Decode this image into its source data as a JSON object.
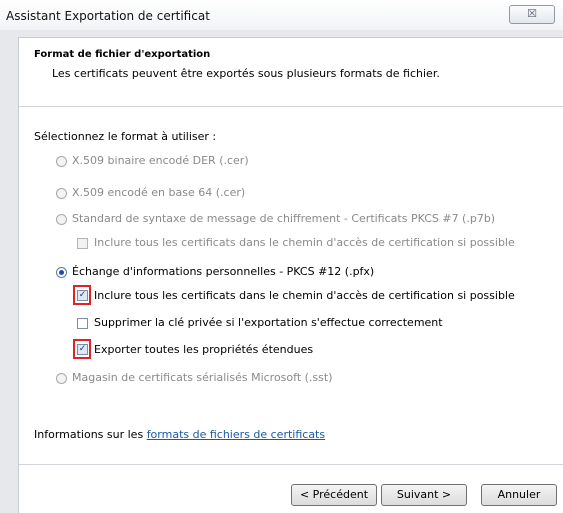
{
  "window": {
    "title": "Assistant Exportation de certificat",
    "close_glyph": "☒"
  },
  "header": {
    "title": "Format de fichier d'exportation",
    "subtitle": "Les certificats peuvent être exportés sous plusieurs formats de fichier."
  },
  "prompt": "Sélectionnez le format à utiliser :",
  "options": {
    "der": {
      "label": "X.509 binaire encodé DER (.cer)",
      "enabled": false,
      "selected": false
    },
    "base64": {
      "label": "X.509 encodé en base 64 (.cer)",
      "enabled": false,
      "selected": false
    },
    "pkcs7": {
      "label": "Standard de syntaxe de message de chiffrement - Certificats PKCS #7 (.p7b)",
      "enabled": false,
      "selected": false
    },
    "pkcs7_include": {
      "label": "Inclure tous les certificats dans le chemin d'accès de certification si possible",
      "checked": false,
      "enabled": false
    },
    "pfx": {
      "label": "Échange d'informations personnelles - PKCS #12 (.pfx)",
      "enabled": true,
      "selected": true
    },
    "pfx_include": {
      "label": "Inclure tous les certificats dans le chemin d'accès de certification si possible",
      "checked": true,
      "enabled": true
    },
    "pfx_delete_key": {
      "label": "Supprimer la clé privée si l'exportation s'effectue correctement",
      "checked": false,
      "enabled": true
    },
    "pfx_export_props": {
      "label": "Exporter toutes les propriétés étendues",
      "checked": true,
      "enabled": true
    },
    "sst": {
      "label": "Magasin de certificats sérialisés Microsoft (.sst)",
      "enabled": false,
      "selected": false
    }
  },
  "info": {
    "prefix": "Informations sur les ",
    "link": "formats de fichiers de certificats"
  },
  "buttons": {
    "back": "< Précédent",
    "next": "Suivant >",
    "cancel": "Annuler"
  },
  "colors": {
    "highlight": "#e0222a",
    "link": "#1a5aa5"
  }
}
